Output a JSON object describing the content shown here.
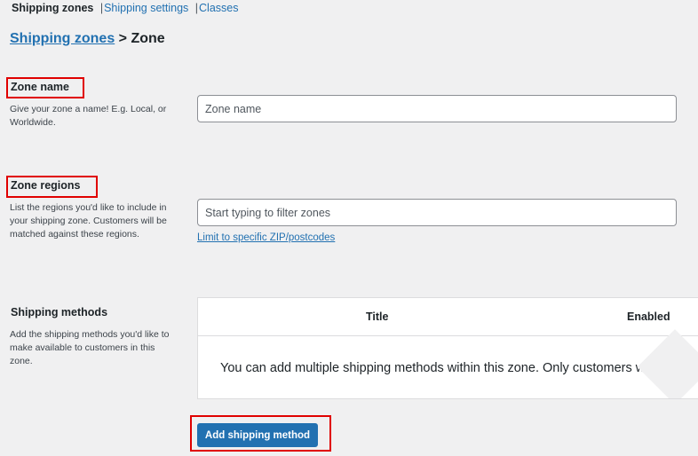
{
  "subnav": {
    "items": [
      {
        "label": "Shipping zones",
        "current": true
      },
      {
        "label": "Shipping settings",
        "current": false
      },
      {
        "label": "Classes",
        "current": false
      }
    ],
    "separator": "|"
  },
  "breadcrumb": {
    "link_label": "Shipping zones",
    "separator": " > ",
    "current": "Zone"
  },
  "zone_name": {
    "title": "Zone name",
    "description": "Give your zone a name! E.g. Local, or Worldwide.",
    "input_value": "",
    "placeholder": "Zone name"
  },
  "zone_regions": {
    "title": "Zone regions",
    "description": "List the regions you'd like to include in your shipping zone. Customers will be matched against these regions.",
    "input_value": "",
    "placeholder": "Start typing to filter zones",
    "zip_link": "Limit to specific ZIP/postcodes"
  },
  "shipping_methods": {
    "title": "Shipping methods",
    "description": "Add the shipping methods you'd like to make available to customers in this zone.",
    "columns": [
      "Title",
      "Enabled"
    ],
    "empty_message": "You can add multiple shipping methods within this zone. Only customers within t",
    "add_button": "Add shipping method"
  },
  "colors": {
    "accent": "#2271b1",
    "annotation_box": "#e00000",
    "background": "#f0f0f1"
  }
}
